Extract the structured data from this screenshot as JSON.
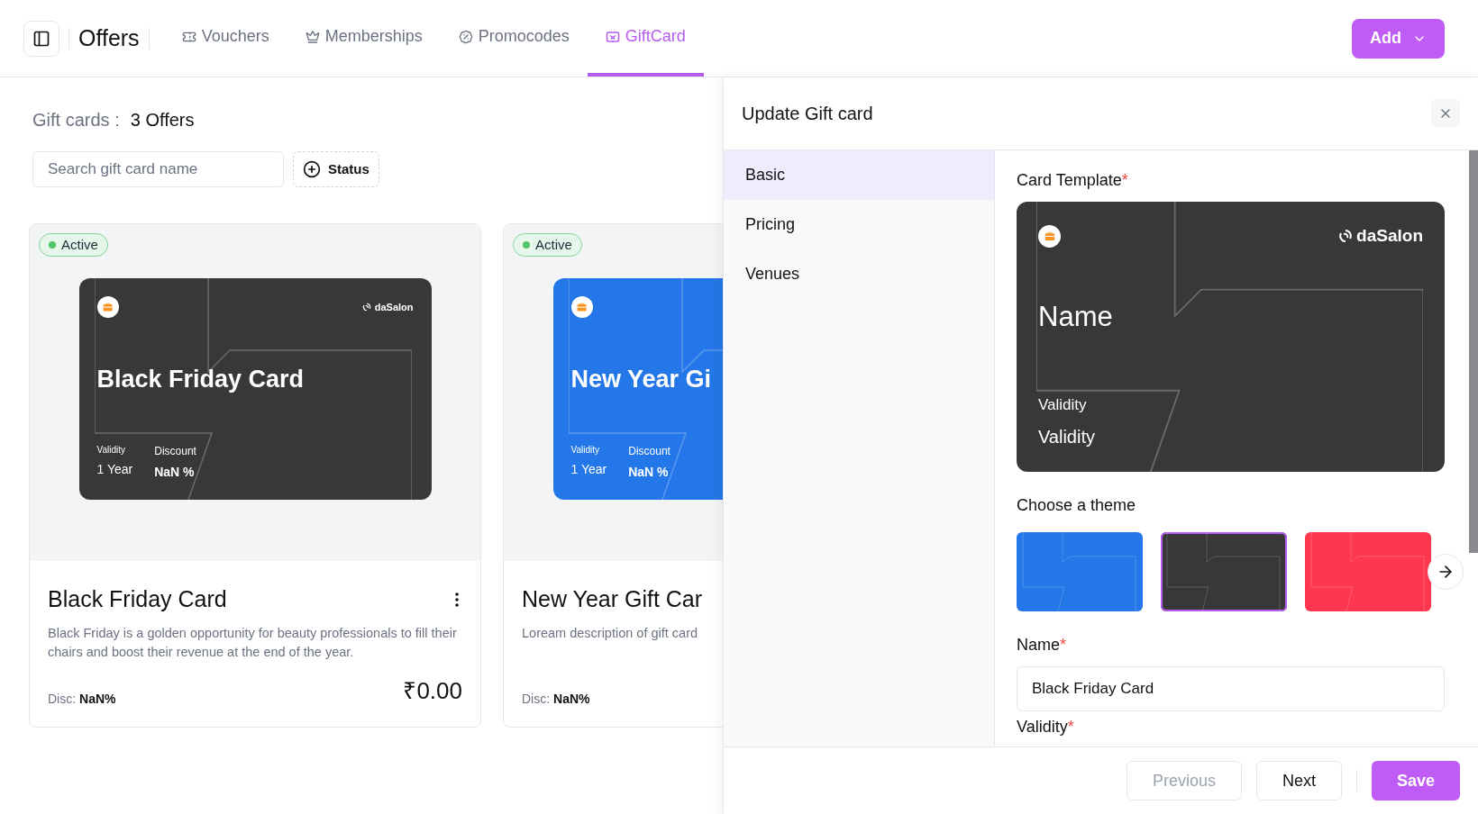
{
  "header": {
    "title": "Offers",
    "tabs": [
      {
        "label": "Vouchers",
        "selected": false
      },
      {
        "label": "Memberships",
        "selected": false
      },
      {
        "label": "Promocodes",
        "selected": false
      },
      {
        "label": "GiftCard",
        "selected": true
      }
    ],
    "add_button": "Add"
  },
  "list": {
    "label": "Gift cards :",
    "count": "3 Offers",
    "search": {
      "placeholder": "Search gift card name"
    },
    "status_filter": "Status",
    "cards": [
      {
        "status": "Active",
        "color": "#383838",
        "preview": {
          "name": "Black Friday Card",
          "brand": "daSalon",
          "validity_label": "Validity",
          "validity": "1 Year",
          "discount_label": "Discount",
          "discount": "NaN %"
        },
        "title": "Black Friday Card",
        "description": "Black Friday is a golden opportunity for beauty professionals to fill their chairs and boost their revenue at the end of the year.",
        "disc_label": "Disc:",
        "disc": "NaN%",
        "price": "₹0.00"
      },
      {
        "status": "Active",
        "color": "#2477e8",
        "preview": {
          "name": "New Year Gi",
          "validity_label": "Validity",
          "validity": "1 Year",
          "discount_label": "Discount",
          "discount": "NaN %"
        },
        "title": "New Year Gift Car",
        "description": "Loream description of gift card",
        "disc_label": "Disc:",
        "disc": "NaN%"
      }
    ]
  },
  "panel": {
    "title": "Update Gift card",
    "nav": [
      {
        "label": "Basic",
        "selected": true
      },
      {
        "label": "Pricing",
        "selected": false
      },
      {
        "label": "Venues",
        "selected": false
      }
    ],
    "template_label": "Card Template",
    "template_mark": "*",
    "template": {
      "color": "#383838",
      "brand": "daSalon",
      "name": "Name",
      "validity_label": "Validity",
      "validity": "Validity"
    },
    "theme_label": "Choose a theme",
    "themes": [
      {
        "color": "#2477e8",
        "selected": false
      },
      {
        "color": "#383838",
        "selected": true
      },
      {
        "color": "#fe374f",
        "selected": false
      }
    ],
    "name_label": "Name",
    "name_mark": "*",
    "name_value": "Black Friday Card",
    "validity_label": "Validity",
    "validity_mark": "*",
    "buttons": [
      {
        "label": "Previous",
        "kind": "outline",
        "disabled": true
      },
      {
        "label": "Next",
        "kind": "outline",
        "disabled": false
      },
      {
        "label": "Save",
        "kind": "primary",
        "disabled": false
      }
    ]
  }
}
